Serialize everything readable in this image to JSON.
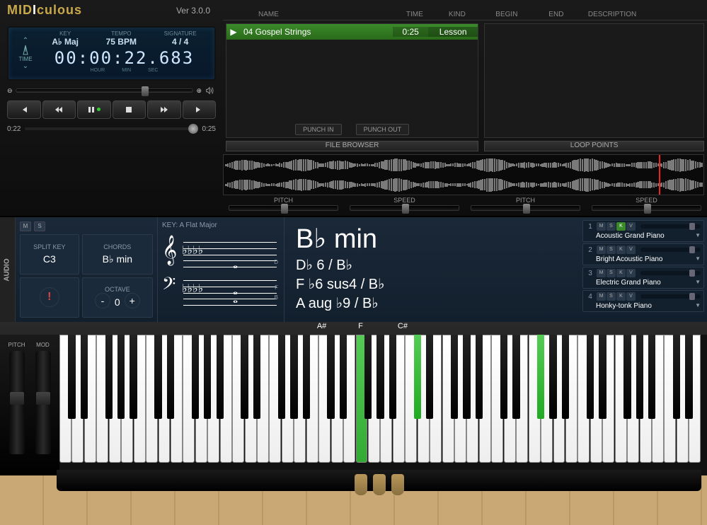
{
  "app": {
    "name": "MIDIculous",
    "version": "Ver 3.0.0"
  },
  "headers": {
    "name": "NAME",
    "time": "TIME",
    "kind": "KIND",
    "begin": "BEGIN",
    "end": "END",
    "desc": "DESCRIPTION"
  },
  "lcd": {
    "time_label": "TIME",
    "key_label": "KEY",
    "key": "A♭ Maj",
    "tempo_label": "TEMPO",
    "tempo": "75 BPM",
    "sig_label": "SIGNATURE",
    "sig": "4 / 4",
    "big_time": "00:00:22.683",
    "hour": "HOUR",
    "min": "MIN",
    "sec": "SEC"
  },
  "position": {
    "start": "0:22",
    "end": "0:25"
  },
  "file": {
    "name": "04 Gospel Strings",
    "time": "0:25",
    "kind": "Lesson"
  },
  "punch": {
    "in": "PUNCH IN",
    "out": "PUNCH OUT"
  },
  "sections": {
    "file_browser": "FILE BROWSER",
    "loop_points": "LOOP POINTS"
  },
  "sliders": {
    "pitch": "PITCH",
    "speed": "SPEED"
  },
  "audio_tab": "AUDIO",
  "left": {
    "split_label": "SPLIT KEY",
    "split": "C3",
    "chords_label": "CHORDS",
    "chords": "B♭ min",
    "octave_label": "OCTAVE",
    "octave": "0",
    "key_label": "KEY: A Flat Major",
    "minus": "-",
    "plus": "+",
    "alert": "!"
  },
  "chord": {
    "main": "B♭ min",
    "sub1": "D♭ 6 / B♭",
    "sub2": "F ♭6 sus4 / B♭",
    "sub3": "A aug ♭9 / B♭"
  },
  "instruments": [
    {
      "num": "1",
      "name": "Acoustic Grand Piano",
      "k_on": true
    },
    {
      "num": "2",
      "name": "Bright Acoustic Piano",
      "k_on": false
    },
    {
      "num": "3",
      "name": "Electric Grand Piano",
      "k_on": false
    },
    {
      "num": "4",
      "name": "Honky-tonk Piano",
      "k_on": false
    }
  ],
  "note_labels": {
    "n1": "A#",
    "n2": "F",
    "n3": "C#"
  },
  "wheels": {
    "pitch": "PITCH",
    "mod": "MOD"
  },
  "staff_notes": {
    "d": "D",
    "f": "F",
    "b": "B"
  },
  "mskv": {
    "m": "M",
    "s": "S",
    "k": "K",
    "v": "V"
  }
}
